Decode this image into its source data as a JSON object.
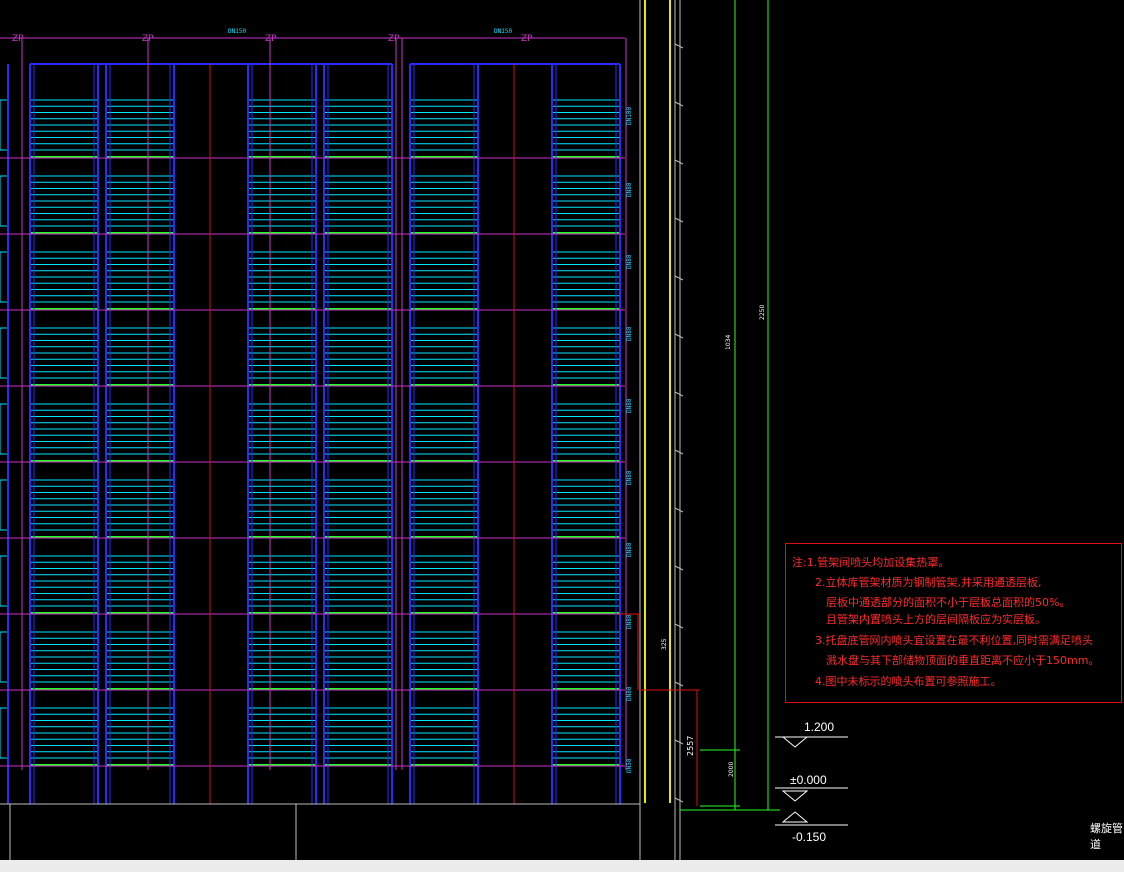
{
  "drawing": {
    "top_labels": [
      "ZP",
      "ZP",
      "ZP",
      "ZP",
      "ZP"
    ],
    "pipe_tags_top": [
      "DN150",
      "DN150"
    ],
    "pipe_tags_side": [
      "DN100",
      "DN80",
      "DN80",
      "DN80",
      "DN80",
      "DN80",
      "DN80",
      "DN80",
      "DN80",
      "DN50"
    ],
    "dim_vertical_1": "325",
    "dim_vertical_2": "2557",
    "dim_mid_1": "1034",
    "dim_mid_2": "2000",
    "dim_tall": "2250",
    "right_edge_label": "螺旋管道"
  },
  "notes": [
    "注:1.管架间喷头均加设集热罩。",
    "2.立体库管架材质为钢制管架,并采用通透层板,",
    "层板中通透部分的面积不小于层板总面积的50%。",
    "且管架内置喷头上方的层间隔板应为实层板。",
    "3.托盘底管网内喷头宜设置在最不利位置,同时需满足喷头",
    "溅水盘与其下部储物顶面的垂直距离不应小于150mm。",
    "4.图中未标示的喷头布置可参照施工。"
  ],
  "levels": {
    "l1": "1.200",
    "l2": "±0.000",
    "l3": "-0.150"
  },
  "colors": {
    "frame": "#2a2aff",
    "shelf": "#00e5ff",
    "pipe_green": "#22ff22",
    "pipe_magenta": "#cc33cc",
    "column_red": "#d01010",
    "wall_yellow": "#e8e800",
    "note_red": "#ff2a2a"
  }
}
